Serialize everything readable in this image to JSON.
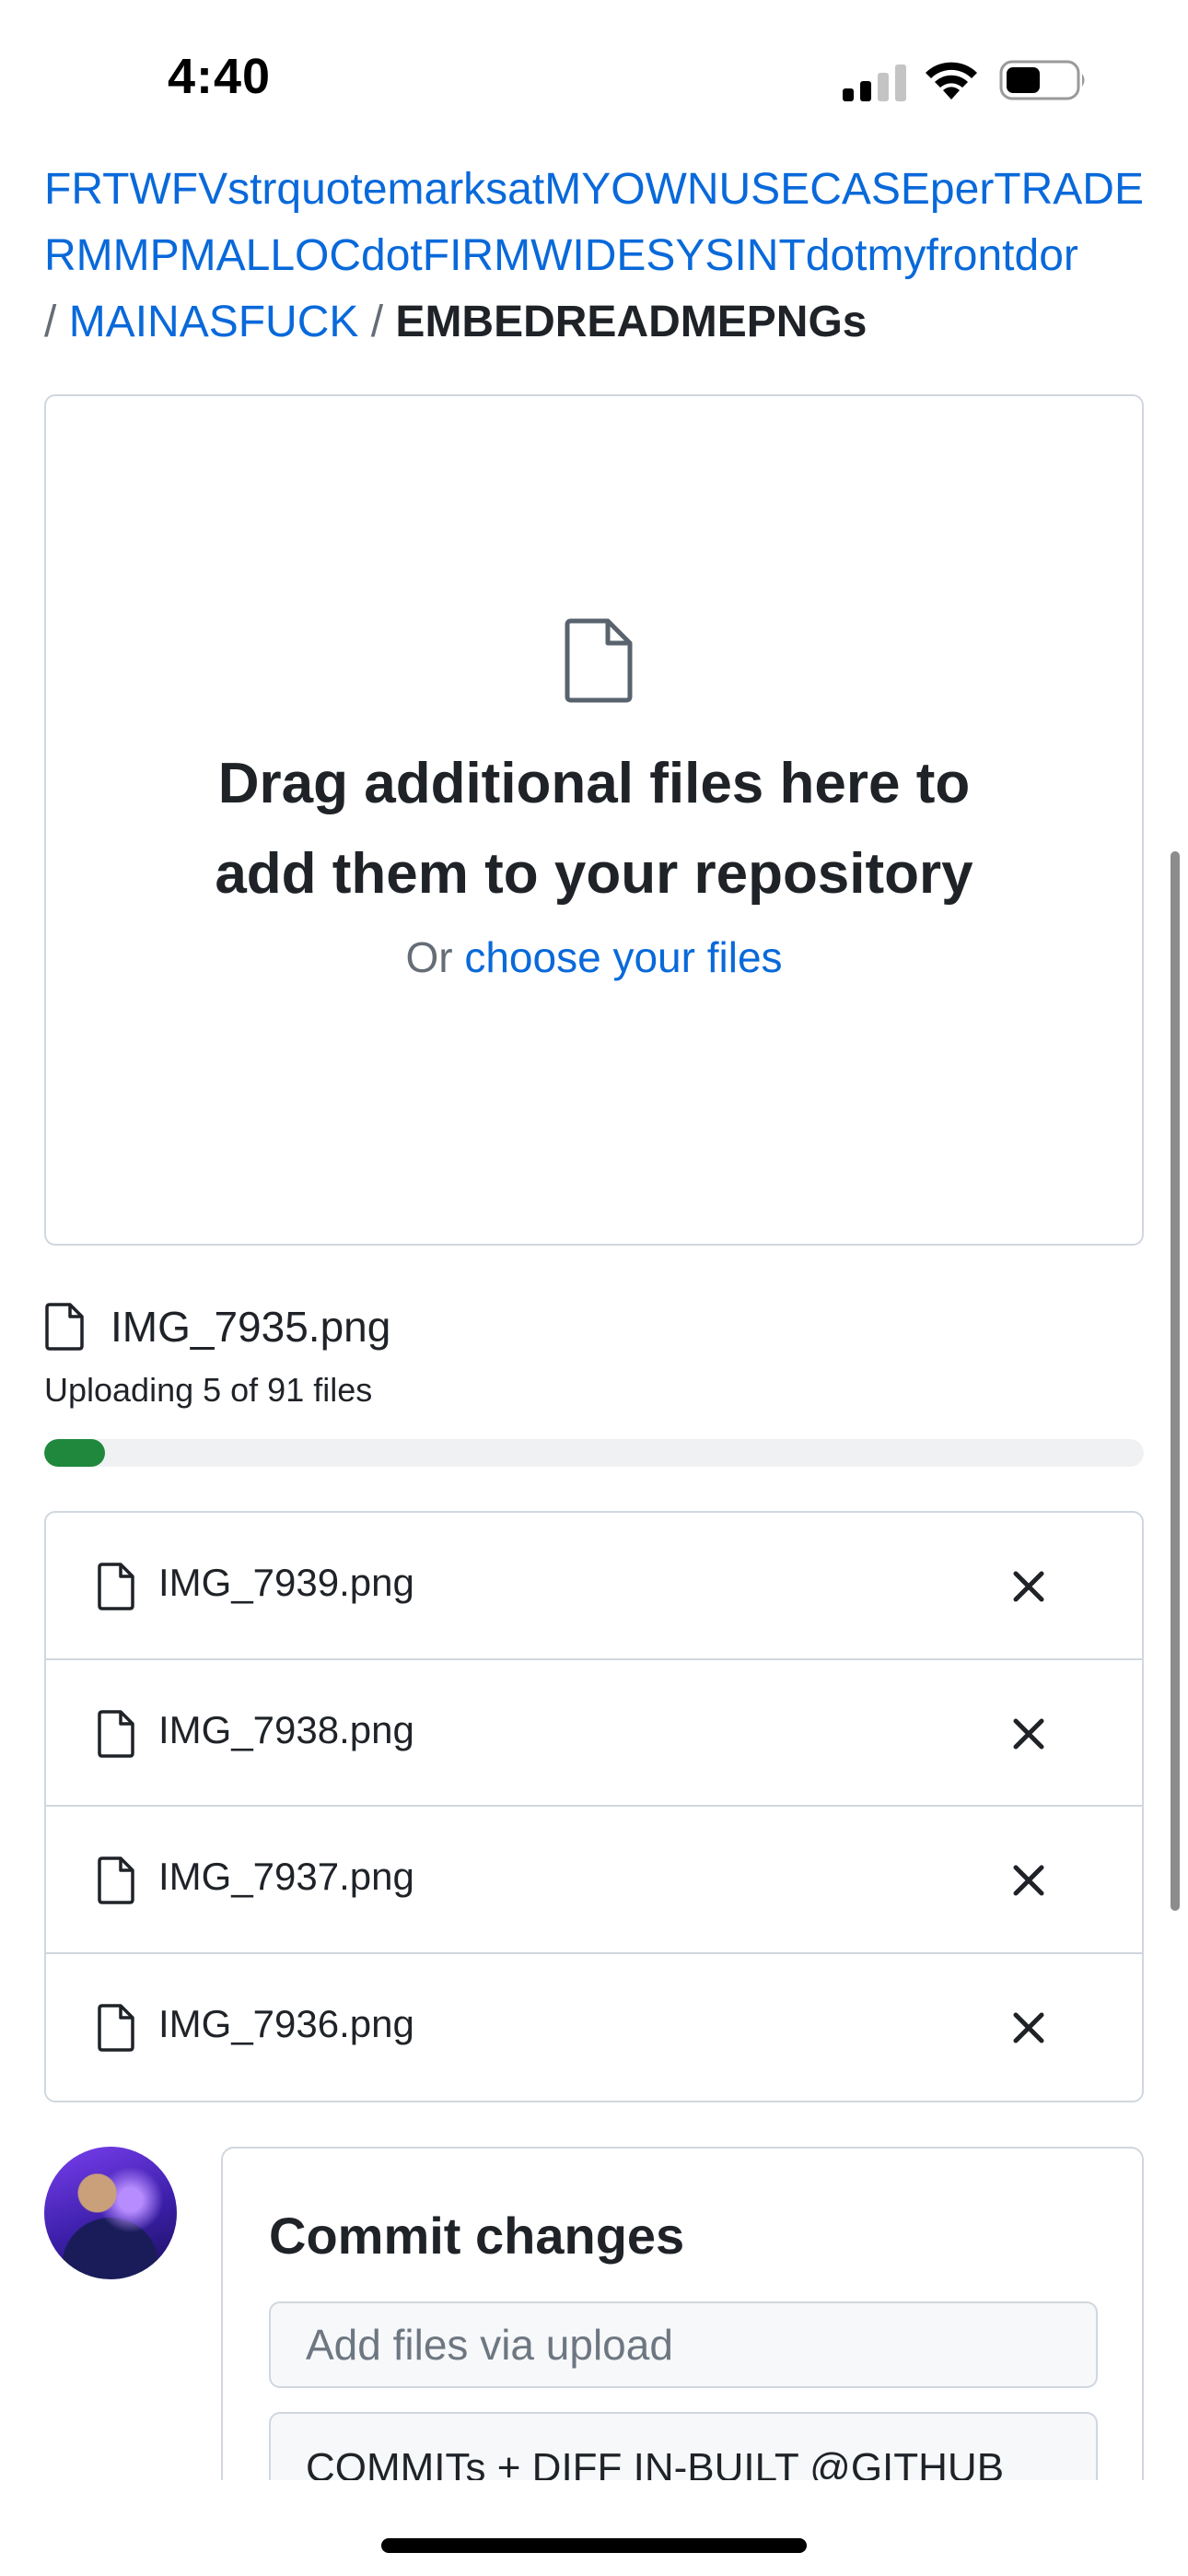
{
  "status_bar": {
    "time": "4:40"
  },
  "breadcrumb": {
    "line1": "FRTWFVstrquotemarksatMYOWNUSECASEperTRADE",
    "line2": "RMMPMALLOCdotFIRMWIDESYSINTdotmyfrontdor",
    "separator": "/",
    "folder": "MAINASFUCK",
    "current": "EMBEDREADMEPNGs"
  },
  "dropzone": {
    "title_line1": "Drag additional files here to",
    "title_line2": "add them to your repository",
    "or_text": "Or",
    "choose_link": "choose your files"
  },
  "upload": {
    "current_file": "IMG_7935.png",
    "status": "Uploading 5 of 91 files",
    "progress": 0.055
  },
  "files": [
    {
      "name": "IMG_7939.png"
    },
    {
      "name": "IMG_7938.png"
    },
    {
      "name": "IMG_7937.png"
    },
    {
      "name": "IMG_7936.png"
    }
  ],
  "commit": {
    "title": "Commit changes",
    "summary_placeholder": "Add files via upload",
    "description_value": "COMMITs + DIFF IN-BUILT @GITHUB"
  },
  "colors": {
    "link": "#0969da",
    "progress": "#1f883d",
    "border": "#d0d7de"
  }
}
